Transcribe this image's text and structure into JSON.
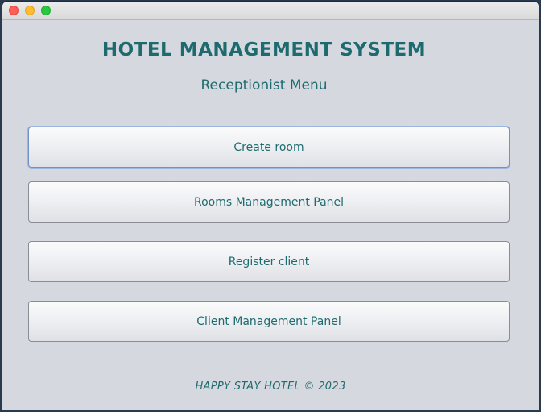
{
  "window": {
    "controls": [
      "close-icon",
      "minimize-icon",
      "zoom-icon"
    ]
  },
  "header": {
    "title": "HOTEL MANAGEMENT SYSTEM",
    "subtitle": "Receptionist Menu"
  },
  "menu": {
    "create_room": "Create room",
    "rooms_management": "Rooms Management Panel",
    "register_client": "Register client",
    "client_management": "Client Management Panel"
  },
  "footer": {
    "text": "HAPPY STAY HOTEL © 2023"
  },
  "colors": {
    "accent_text": "#1d6b6e",
    "window_background": "#d6d8df",
    "focus_ring": "#6f93c8"
  }
}
